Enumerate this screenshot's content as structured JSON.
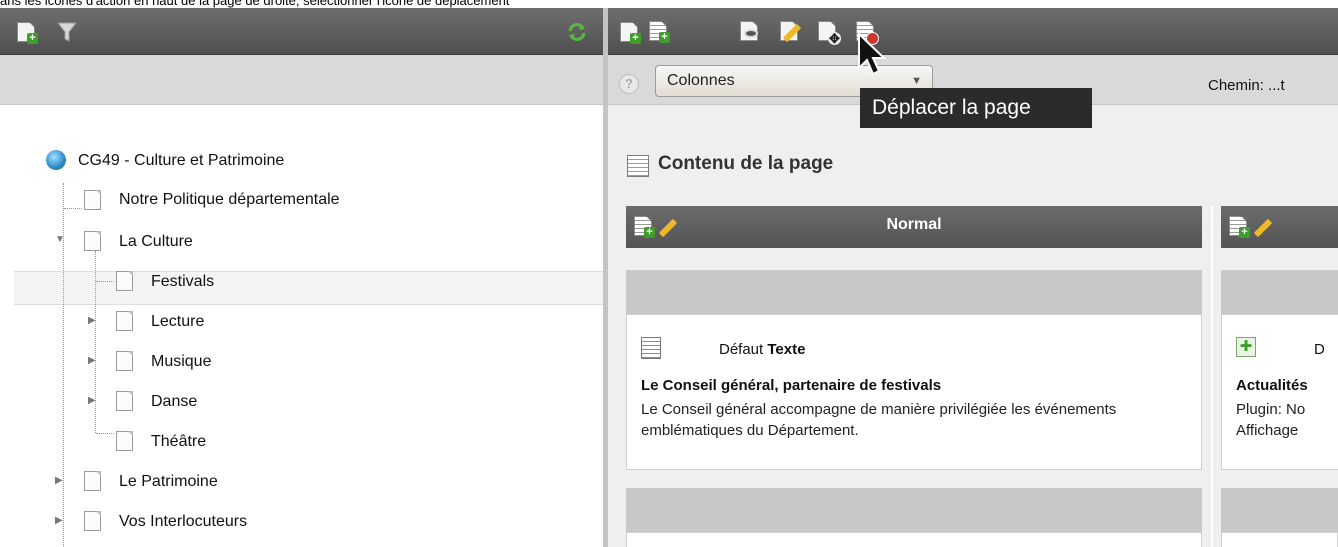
{
  "caption": "ans les icônes d'action en haut de la page de droite, sélectionner l'icône de déplacement",
  "left_toolbar": {
    "icons": [
      "new-page-icon",
      "filter-icon",
      "refresh-icon"
    ]
  },
  "right_toolbar": {
    "icons": [
      "new-page-icon",
      "new-content-icon",
      "view-page-icon",
      "edit-page-icon",
      "move-page-icon",
      "history-icon"
    ]
  },
  "tooltip": "Déplacer la page",
  "select": {
    "value": "Colonnes"
  },
  "chemin": "Chemin: ...t",
  "tree": {
    "root": "CG49 - Culture et Patrimoine",
    "nodes": [
      {
        "label": "Notre Politique départementale"
      },
      {
        "label": "La Culture"
      },
      {
        "label": "Festivals"
      },
      {
        "label": "Lecture"
      },
      {
        "label": "Musique"
      },
      {
        "label": "Danse"
      },
      {
        "label": "Théâtre"
      },
      {
        "label": "Le Patrimoine"
      },
      {
        "label": "Vos Interlocuteurs"
      }
    ]
  },
  "content": {
    "title": "Contenu de la page",
    "columns": [
      {
        "header": "Normal",
        "card": {
          "type_prefix": "Défaut",
          "type": "Texte",
          "title": "Le Conseil général, partenaire de festivals",
          "text": "Le Conseil général accompagne de manière privilégiée les événements emblématiques du Département."
        }
      },
      {
        "header": "",
        "card": {
          "type_prefix": "D",
          "title": "Actualités",
          "line1": "Plugin: No",
          "line2": "Affichage"
        }
      }
    ]
  },
  "colors": {
    "toolbar": "#5c5c5c",
    "accent_green": "#3e9e2c",
    "tooltip_bg": "#2b2b2b"
  }
}
